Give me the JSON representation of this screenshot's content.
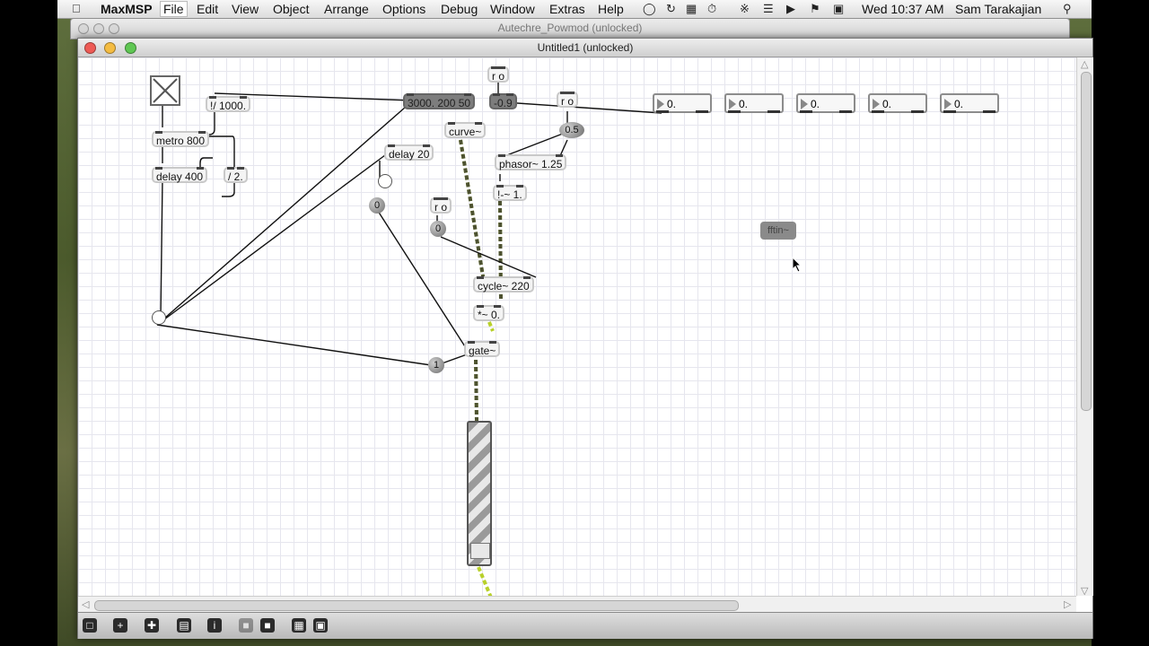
{
  "menubar": {
    "app": "MaxMSP",
    "items": [
      "File",
      "Edit",
      "View",
      "Object",
      "Arrange",
      "Options",
      "Debug",
      "Window",
      "Extras",
      "Help"
    ],
    "clock": "Wed 10:37 AM",
    "user": "Sam Tarakajian"
  },
  "back_window": {
    "title": "Autechre_Powmod (unlocked)"
  },
  "window": {
    "title": "Untitled1 (unlocked)"
  },
  "patch": {
    "objects": {
      "div_1000": "!/ 1000.",
      "metro": "metro 800",
      "delay400": "delay 400",
      "div2": "/ 2.",
      "delay20": "delay 20",
      "msg_curve_list": "3000. 200 50",
      "msg_neg09": "-0.9",
      "curve": "curve~",
      "phasor": "phasor~ 1.25",
      "minus1": "!-~ 1.",
      "cycle": "cycle~ 220",
      "times": "*~ 0.",
      "gate": "gate~",
      "fftin": "fftin~",
      "ro1": "r o",
      "ro2": "r o",
      "ro3": "r o"
    },
    "numbers": {
      "num_05": "0.5",
      "num_0a": "0",
      "num_0b": "0",
      "num_1": "1"
    },
    "number_boxes": [
      "0.",
      "0.",
      "0.",
      "0.",
      "0."
    ]
  },
  "icons": {
    "wire_signal_color": "#b8d02a",
    "wire_control_color": "#000000"
  }
}
